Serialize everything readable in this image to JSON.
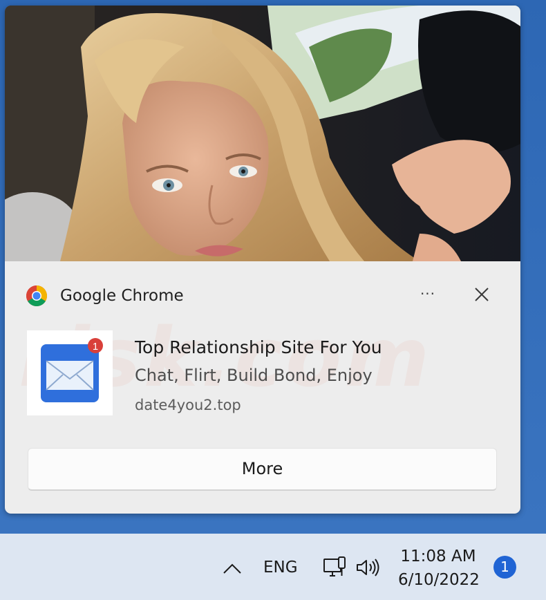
{
  "notification": {
    "app_name": "Google Chrome",
    "more_options_label": "···",
    "title": "Top Relationship Site For You",
    "body": "Chat, Flirt, Build Bond, Enjoy",
    "source": "date4you2.top",
    "thumbnail_badge": "1",
    "action_label": "More",
    "hero_image": "photo-of-woman-in-car"
  },
  "taskbar": {
    "lang": "ENG",
    "time": "11:08 AM",
    "date": "6/10/2022",
    "notification_count": "1"
  },
  "icons": [
    "chrome-icon",
    "close-icon",
    "mail-icon",
    "chevron-up-icon",
    "network-icon",
    "volume-icon"
  ],
  "colors": {
    "toast_bg": "#ededed",
    "desktop_bg": "#2f6bb8",
    "taskbar_bg": "#dde6f2",
    "badge_blue": "#2064d4",
    "mail_badge_red": "#d9403a"
  }
}
